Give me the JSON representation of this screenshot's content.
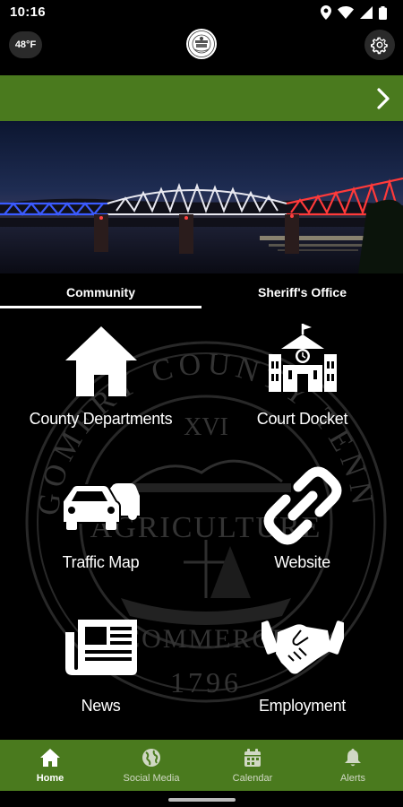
{
  "status_bar": {
    "time": "10:16"
  },
  "header": {
    "temperature": "48°F",
    "logo_icon": "county-seal-icon",
    "settings_icon": "gear-icon"
  },
  "banner": {
    "color": "#4a7a1e",
    "arrow_icon": "chevron-right-icon"
  },
  "hero": {
    "image": "illuminated-bridge-night-photo"
  },
  "tabs": [
    {
      "label": "Community",
      "selected": true
    },
    {
      "label": "Sheriff's Office",
      "selected": false
    }
  ],
  "tiles": [
    {
      "label": "County Departments",
      "icon": "home-icon"
    },
    {
      "label": "Court Docket",
      "icon": "courthouse-icon"
    },
    {
      "label": "Traffic Map",
      "icon": "cars-icon"
    },
    {
      "label": "Website",
      "icon": "link-icon"
    },
    {
      "label": "News",
      "icon": "newspaper-icon"
    },
    {
      "label": "Employment",
      "icon": "handshake-icon"
    }
  ],
  "watermark": {
    "top_text": "MONTGOMERY COUNTY TENNESSEE",
    "numeral": "XVI",
    "agriculture": "AGRICULTURE",
    "commerce": "COMMERCE",
    "year": "1796"
  },
  "bottom_nav": [
    {
      "label": "Home",
      "icon": "home-icon",
      "active": true
    },
    {
      "label": "Social Media",
      "icon": "globe-icon",
      "active": false
    },
    {
      "label": "Calendar",
      "icon": "calendar-icon",
      "active": false
    },
    {
      "label": "Alerts",
      "icon": "bell-icon",
      "active": false
    }
  ],
  "colors": {
    "accent_green": "#4a7a1e",
    "background": "#000000"
  }
}
